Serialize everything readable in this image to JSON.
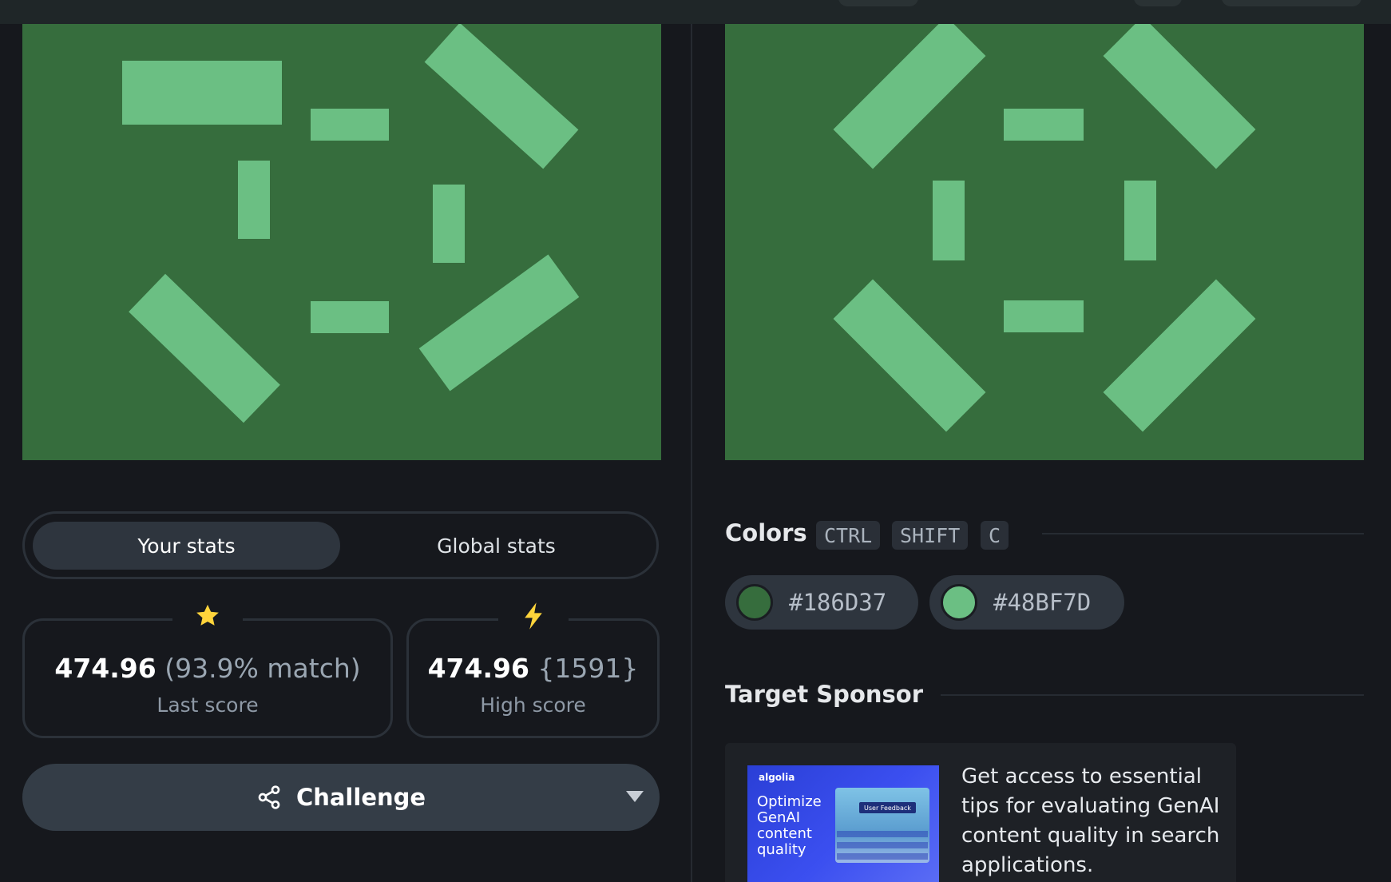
{
  "stats_toggle": {
    "your_stats": "Your stats",
    "global_stats": "Global stats",
    "active": "Your stats"
  },
  "last_score": {
    "icon": "star-icon",
    "icon_color": "#FFD43B",
    "value": "474.96",
    "extra": "(93.9% match)",
    "label": "Last score"
  },
  "high_score": {
    "icon": "lightning-icon",
    "icon_color": "#FFD43B",
    "value": "474.96",
    "extra": "{1591}",
    "label": "High score"
  },
  "challenge": {
    "label": "Challenge",
    "icon": "share-icon"
  },
  "colors_section": {
    "title": "Colors",
    "shortcut": [
      "CTRL",
      "SHIFT",
      "C"
    ],
    "swatches": [
      {
        "hex": "#186D37",
        "label": "#186D37"
      },
      {
        "hex": "#48BF7D",
        "label": "#48BF7D"
      }
    ]
  },
  "target_colors": {
    "background": "#366D3D",
    "shape": "#6BBF83"
  },
  "sponsor": {
    "title": "Target Sponsor",
    "ad_brand": "algolia",
    "ad_headline": "Optimize GenAI content quality",
    "ad_badge": "User Feedback",
    "copy": "Get access to essential tips for evaluating GenAI content quality in search applications."
  }
}
